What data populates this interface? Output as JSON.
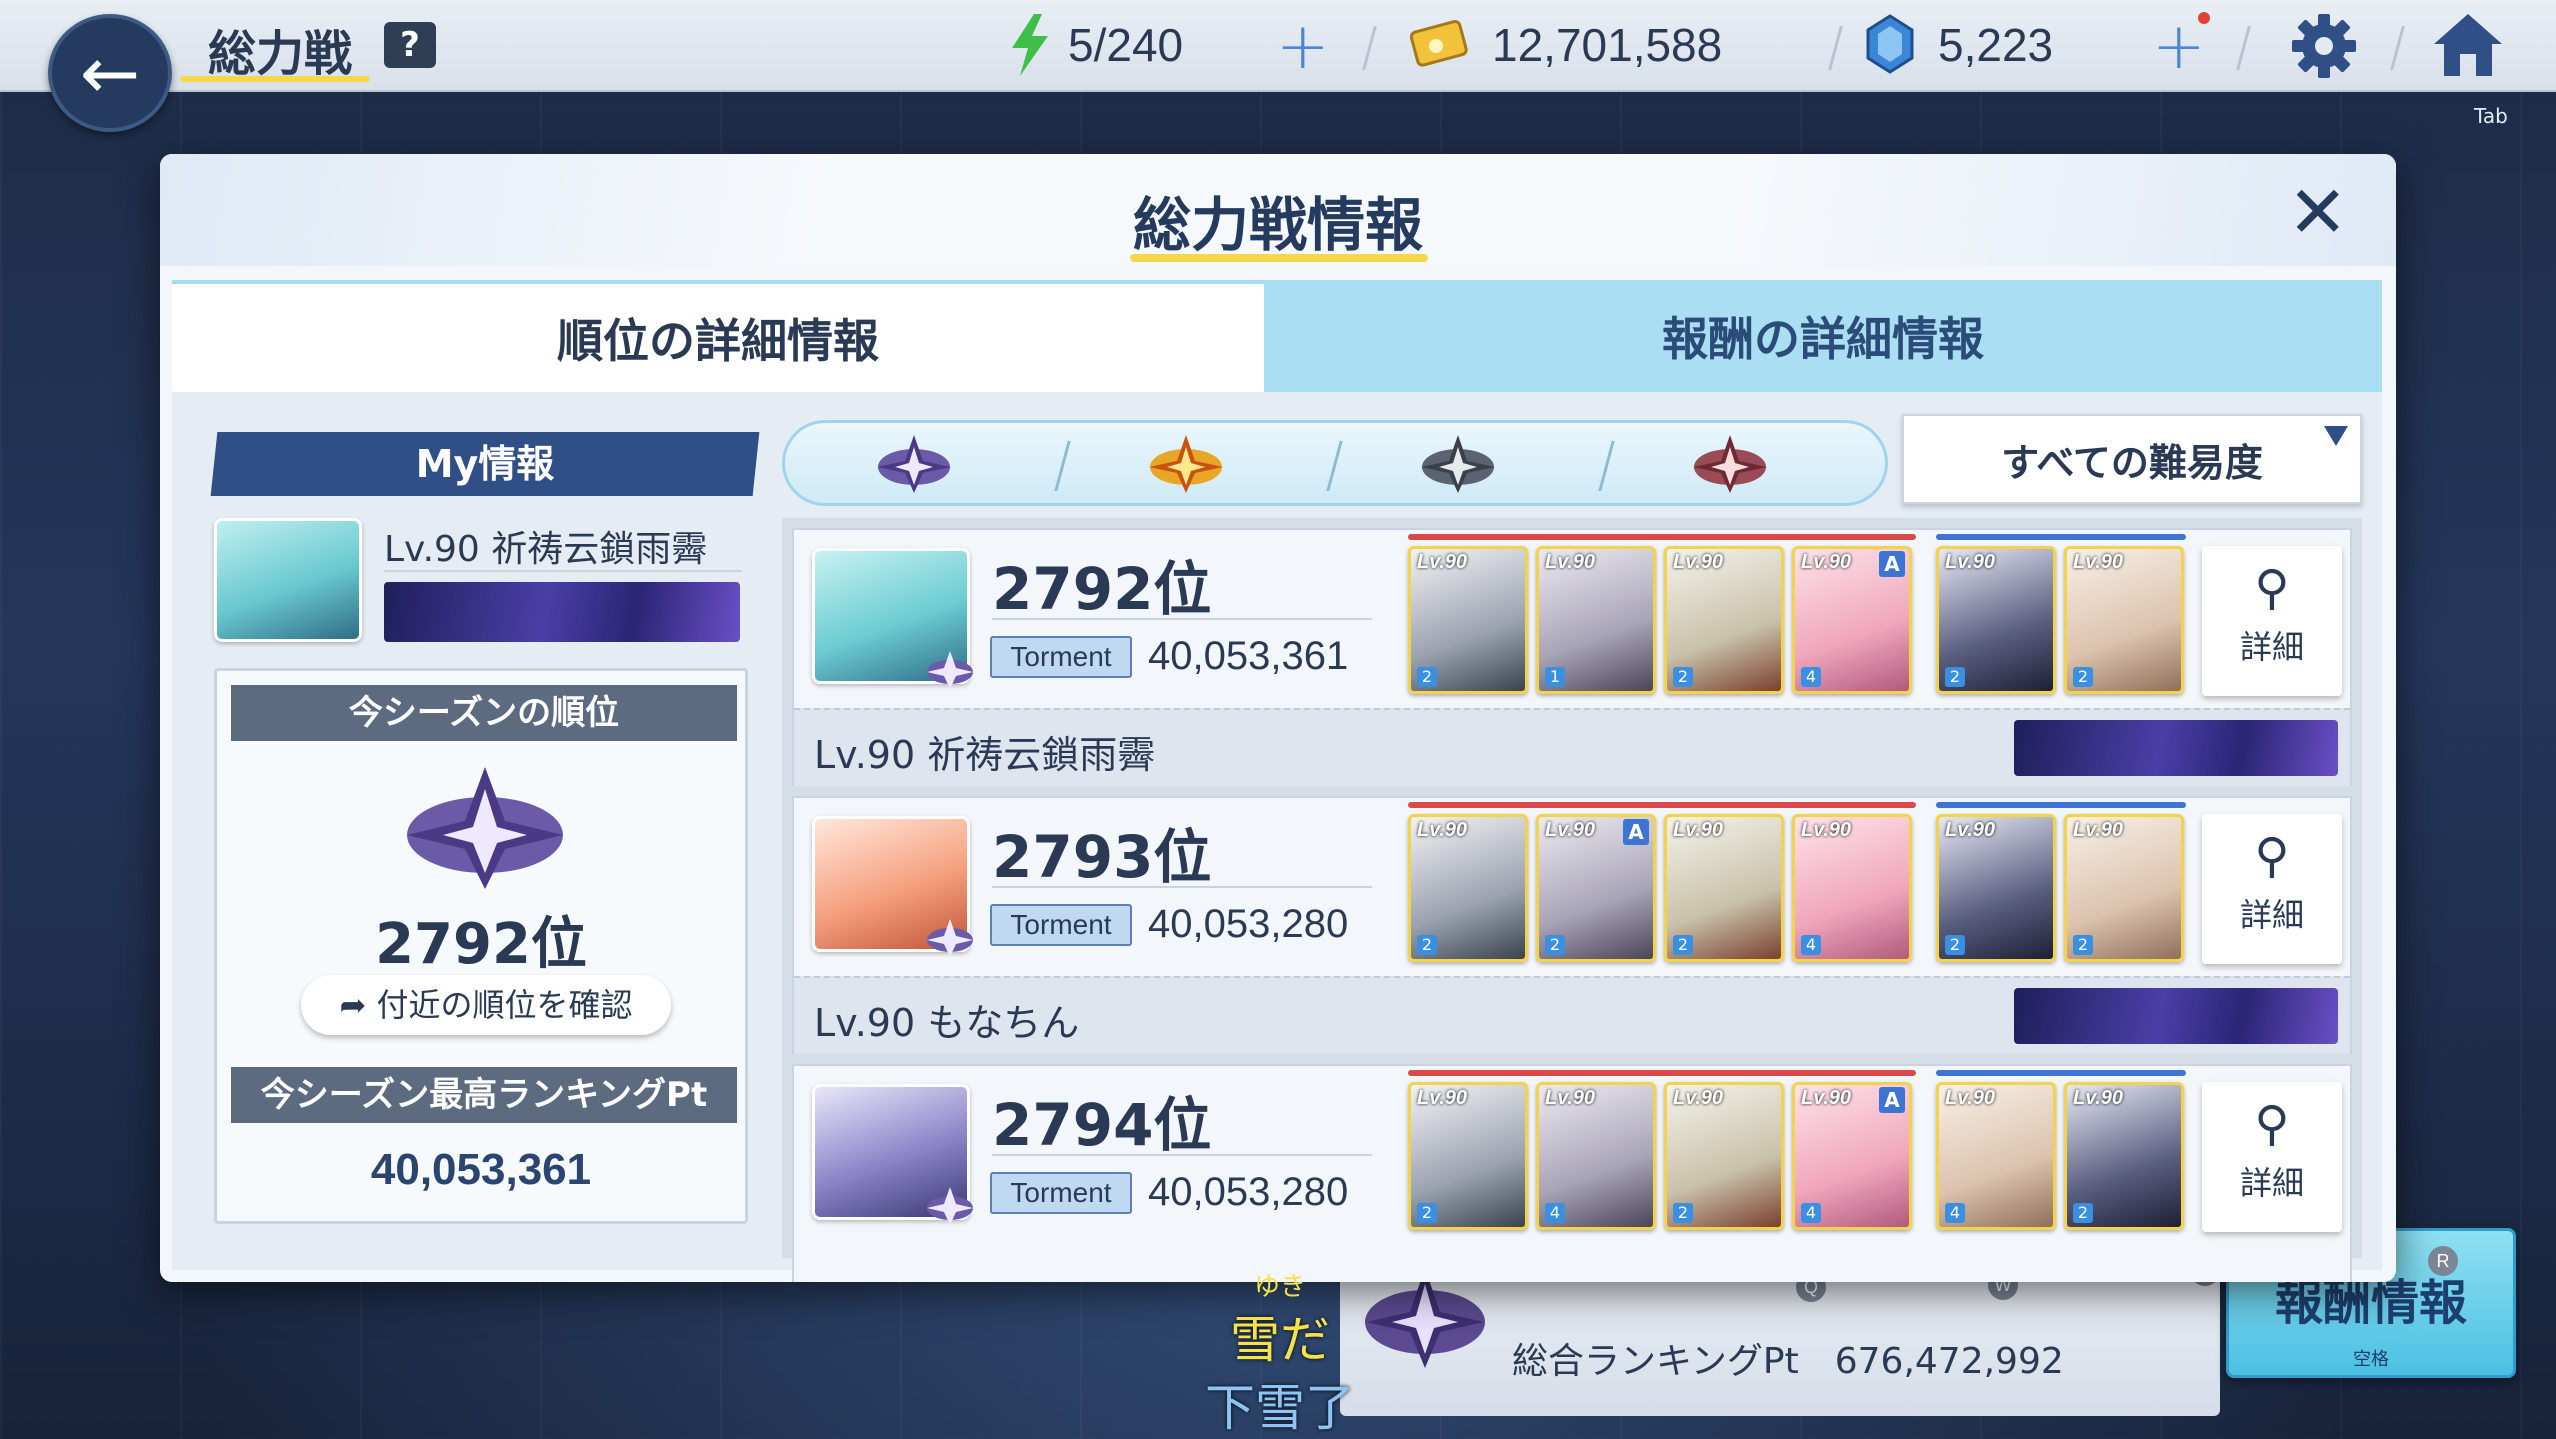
{
  "topbar": {
    "title": "総力戦",
    "help": "?",
    "stamina": "5/240",
    "credits": "12,701,588",
    "gems": "5,223",
    "tab_hint": "Tab"
  },
  "modal": {
    "title": "総力戦情報",
    "tabs": [
      "順位の詳細情報",
      "報酬の詳細情報"
    ],
    "my_info": {
      "header": "My情報",
      "level_name": "Lv.90 祈祷云鎖雨霽",
      "season_rank_label": "今シーズンの順位",
      "rank": "2792位",
      "nearby_button": "付近の順位を確認",
      "best_pt_label": "今シーズン最高ランキングPt",
      "best_pt": "40,053,361"
    },
    "difficulty_select": "すべての難易度",
    "detail_label": "詳細",
    "rows": [
      {
        "rank": "2792位",
        "difficulty": "Torment",
        "score": "40,053,361",
        "name": "Lv.90 祈祷云鎖雨霽",
        "units": [
          {
            "lv": "Lv.90",
            "star": "2",
            "tag": ""
          },
          {
            "lv": "Lv.90",
            "star": "1",
            "tag": ""
          },
          {
            "lv": "Lv.90",
            "star": "2",
            "tag": ""
          },
          {
            "lv": "Lv.90",
            "star": "4",
            "tag": "A"
          },
          {
            "lv": "Lv.90",
            "star": "2",
            "tag": ""
          },
          {
            "lv": "Lv.90",
            "star": "2",
            "tag": ""
          }
        ]
      },
      {
        "rank": "2793位",
        "difficulty": "Torment",
        "score": "40,053,280",
        "name": "Lv.90 もなちん",
        "units": [
          {
            "lv": "Lv.90",
            "star": "2",
            "tag": ""
          },
          {
            "lv": "Lv.90",
            "star": "2",
            "tag": "A"
          },
          {
            "lv": "Lv.90",
            "star": "2",
            "tag": ""
          },
          {
            "lv": "Lv.90",
            "star": "4",
            "tag": ""
          },
          {
            "lv": "Lv.90",
            "star": "2",
            "tag": ""
          },
          {
            "lv": "Lv.90",
            "star": "2",
            "tag": ""
          }
        ]
      },
      {
        "rank": "2794位",
        "difficulty": "Torment",
        "score": "40,053,280",
        "name": "",
        "units": [
          {
            "lv": "Lv.90",
            "star": "2",
            "tag": ""
          },
          {
            "lv": "Lv.90",
            "star": "4",
            "tag": ""
          },
          {
            "lv": "Lv.90",
            "star": "2",
            "tag": ""
          },
          {
            "lv": "Lv.90",
            "star": "4",
            "tag": "A"
          },
          {
            "lv": "Lv.90",
            "star": "4",
            "tag": ""
          },
          {
            "lv": "Lv.90",
            "star": "2",
            "tag": ""
          }
        ]
      }
    ]
  },
  "bottom": {
    "total_pt": "総合ランキングPt　676,472,992",
    "reward_button": "報酬情報",
    "reward_hint": "空格",
    "keys": [
      "Q",
      "W",
      "E",
      "R"
    ]
  },
  "subtitle": {
    "ruby": "ゆき",
    "jp": "雪だ",
    "cn": "下雪了"
  },
  "colors": {
    "accent_yellow": "#f4d84a",
    "tab_blue": "#a9def3",
    "header_navy": "#2f4f86"
  }
}
